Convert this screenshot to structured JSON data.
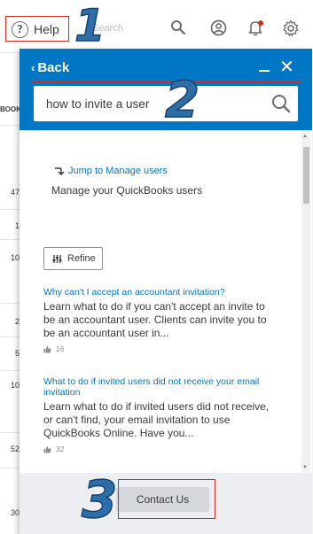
{
  "topbar": {
    "help_label": "Help",
    "help_glyph": "?",
    "search_placeholder": "Search",
    "icons": [
      "search-icon",
      "profile-icon",
      "bell-icon",
      "gear-icon"
    ]
  },
  "annotations": {
    "step1": "1",
    "step2": "2",
    "step3": "3"
  },
  "background_table": {
    "header": "BOOKS",
    "values": [
      "47",
      "1",
      "10",
      "2",
      "5",
      "10",
      "52",
      "30"
    ]
  },
  "panel": {
    "back_label": "Back",
    "search_value": "how to invite a user",
    "jump_link": "Jump to Manage users",
    "jump_subtitle": "Manage your QuickBooks users",
    "refine_label": "Refine",
    "results": [
      {
        "title": "Why can't I accept an accountant invitation?",
        "description": "Learn what to do if you can't accept an invite to be an accountant user. Clients can invite you to be an accountant user in...",
        "votes": "16"
      },
      {
        "title": "What to do if invited users did not receive your email invitation",
        "description": "Learn what to do if invited users did not receive, or can't find, your email invitation to use QuickBooks Online. Have you...",
        "votes": "32"
      }
    ],
    "contact_label": "Contact Us"
  },
  "colors": {
    "brand_blue": "#0077c5",
    "highlight_red": "#d52b1e",
    "annotation_blue": "#2d6ea8"
  }
}
